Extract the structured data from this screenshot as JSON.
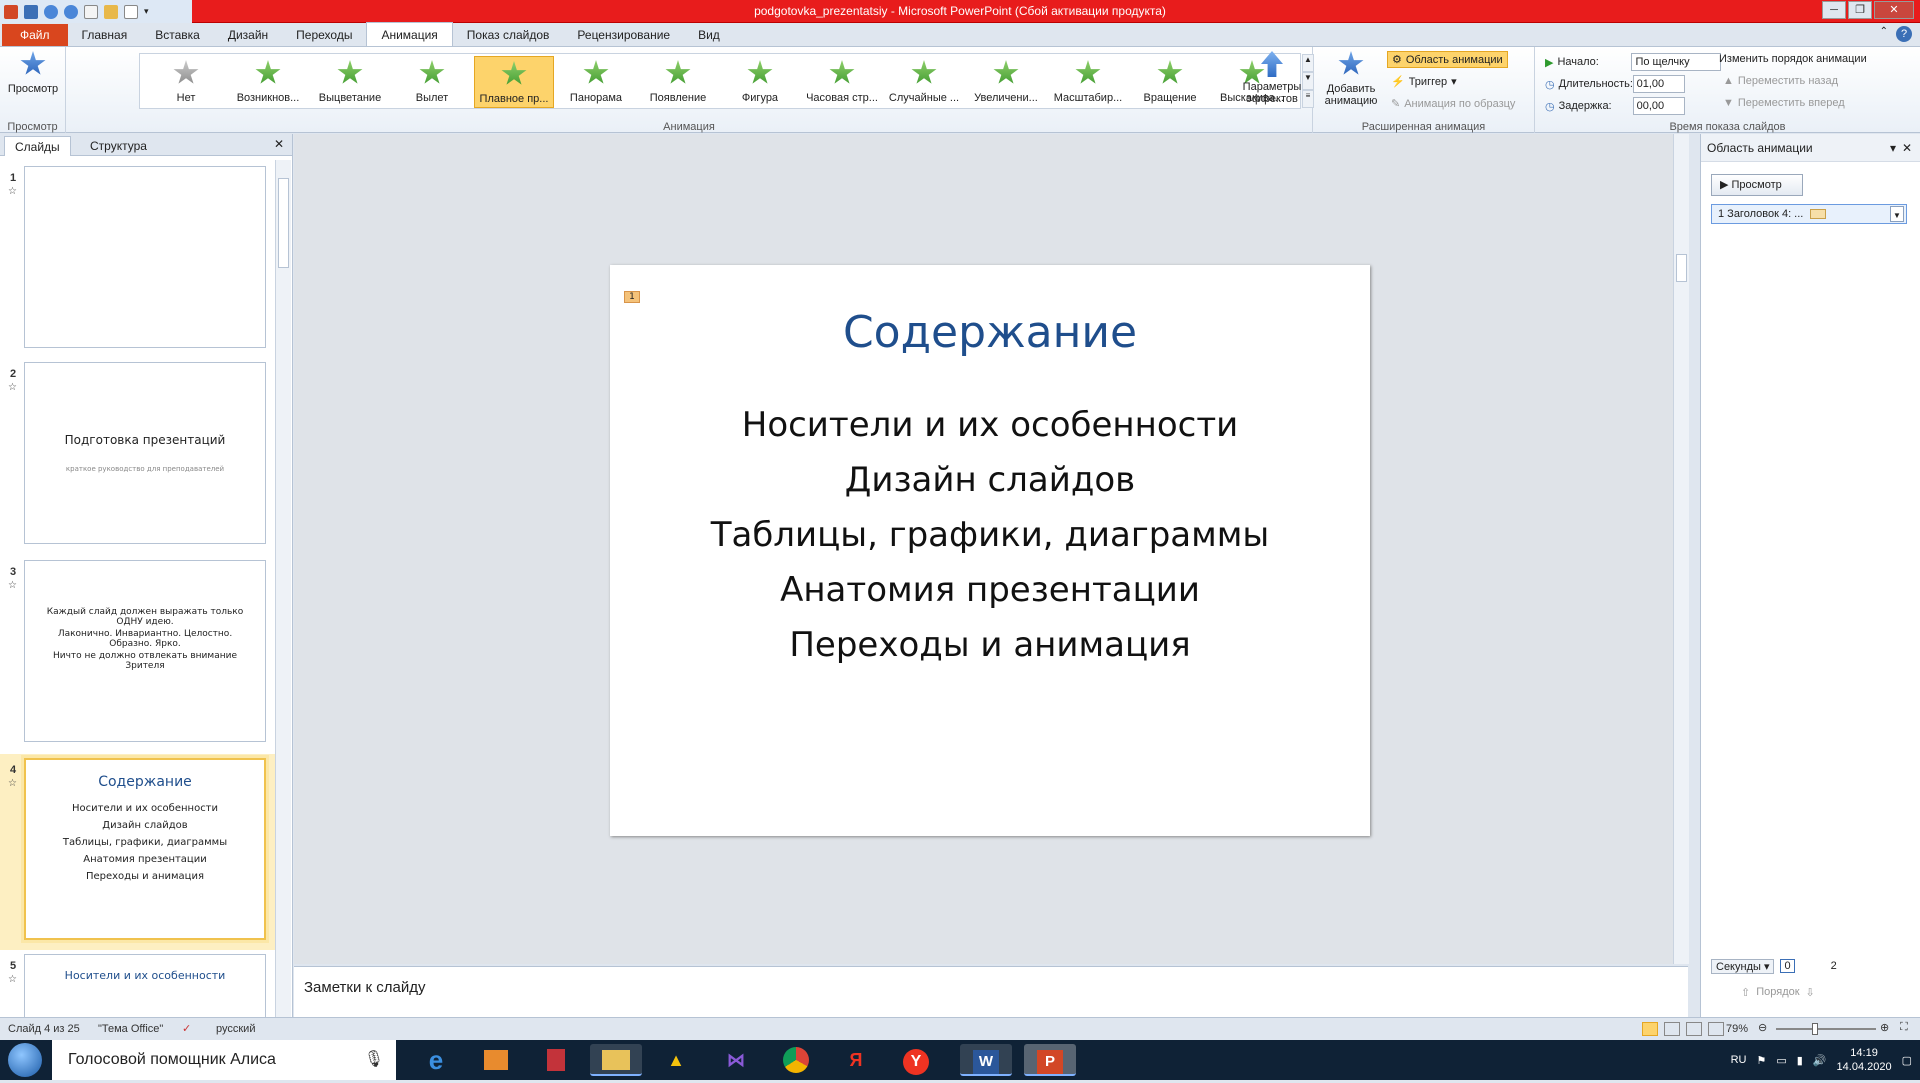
{
  "window": {
    "title": "podgotovka_prezentatsiy - Microsoft PowerPoint (Сбой активации продукта)"
  },
  "tabs": [
    "Файл",
    "Главная",
    "Вставка",
    "Дизайн",
    "Переходы",
    "Анимация",
    "Показ слайдов",
    "Рецензирование",
    "Вид"
  ],
  "ribbon": {
    "preview_label": "Просмотр",
    "preview_group": "Просмотр",
    "animations": [
      "Нет",
      "Возникнов...",
      "Выцветание",
      "Вылет",
      "Плавное пр...",
      "Панорама",
      "Появление",
      "Фигура",
      "Часовая стр...",
      "Случайные ...",
      "Увеличени...",
      "Масштабир...",
      "Вращение",
      "Выскакива..."
    ],
    "animation_group": "Анимация",
    "effect_params": "Параметры эффектов",
    "add_animation": "Добавить анимацию",
    "anim_pane_btn": "Область анимации",
    "trigger": "Триггер",
    "anim_painter": "Анимация по образцу",
    "advanced_group": "Расширенная анимация",
    "start_label": "Начало:",
    "start_value": "По щелчку",
    "duration_label": "Длительность:",
    "duration_value": "01,00",
    "delay_label": "Задержка:",
    "delay_value": "00,00",
    "reorder_title": "Изменить порядок анимации",
    "move_back": "Переместить назад",
    "move_forward": "Переместить вперед",
    "timing_group": "Время показа слайдов"
  },
  "leftpane": {
    "tab_slides": "Слайды",
    "tab_outline": "Структура"
  },
  "thumbs": {
    "t2_title": "Подготовка презентаций",
    "t2_sub": "краткое руководство для преподавателей",
    "t3_l1": "Каждый слайд должен выражать только ОДНУ идею.",
    "t3_l2": "Лаконично. Инвариантно. Целостно. Образно. Ярко.",
    "t3_l3": "Ничто не должно отвлекать внимание Зрителя",
    "t4_title": "Содержание",
    "t4_items": [
      "Носители и их особенности",
      "Дизайн слайдов",
      "Таблицы, графики, диаграммы",
      "Анатомия презентации",
      "Переходы и анимация"
    ],
    "t5_title": "Носители и их особенности",
    "nums": [
      "1",
      "2",
      "3",
      "4",
      "5"
    ]
  },
  "slide": {
    "title": "Содержание",
    "items": [
      "Носители и их особенности",
      "Дизайн слайдов",
      "Таблицы, графики, диаграммы",
      "Анатомия презентации",
      "Переходы и анимация"
    ],
    "anim_marker": "1"
  },
  "notes": {
    "placeholder": "Заметки к слайду"
  },
  "animpane": {
    "title": "Область анимации",
    "play": "Просмотр",
    "item": "1  Заголовок 4: ...",
    "seconds": "Секунды",
    "page_from": "0",
    "page_to": "2",
    "order": "Порядок"
  },
  "status": {
    "slide": "Слайд 4 из 25",
    "theme": "\"Тема Office\"",
    "lang": "русский",
    "zoom": "79%"
  },
  "taskbar": {
    "search": "Голосовой помощник Алиса",
    "lang": "RU",
    "time": "14:19",
    "date": "14.04.2020"
  }
}
